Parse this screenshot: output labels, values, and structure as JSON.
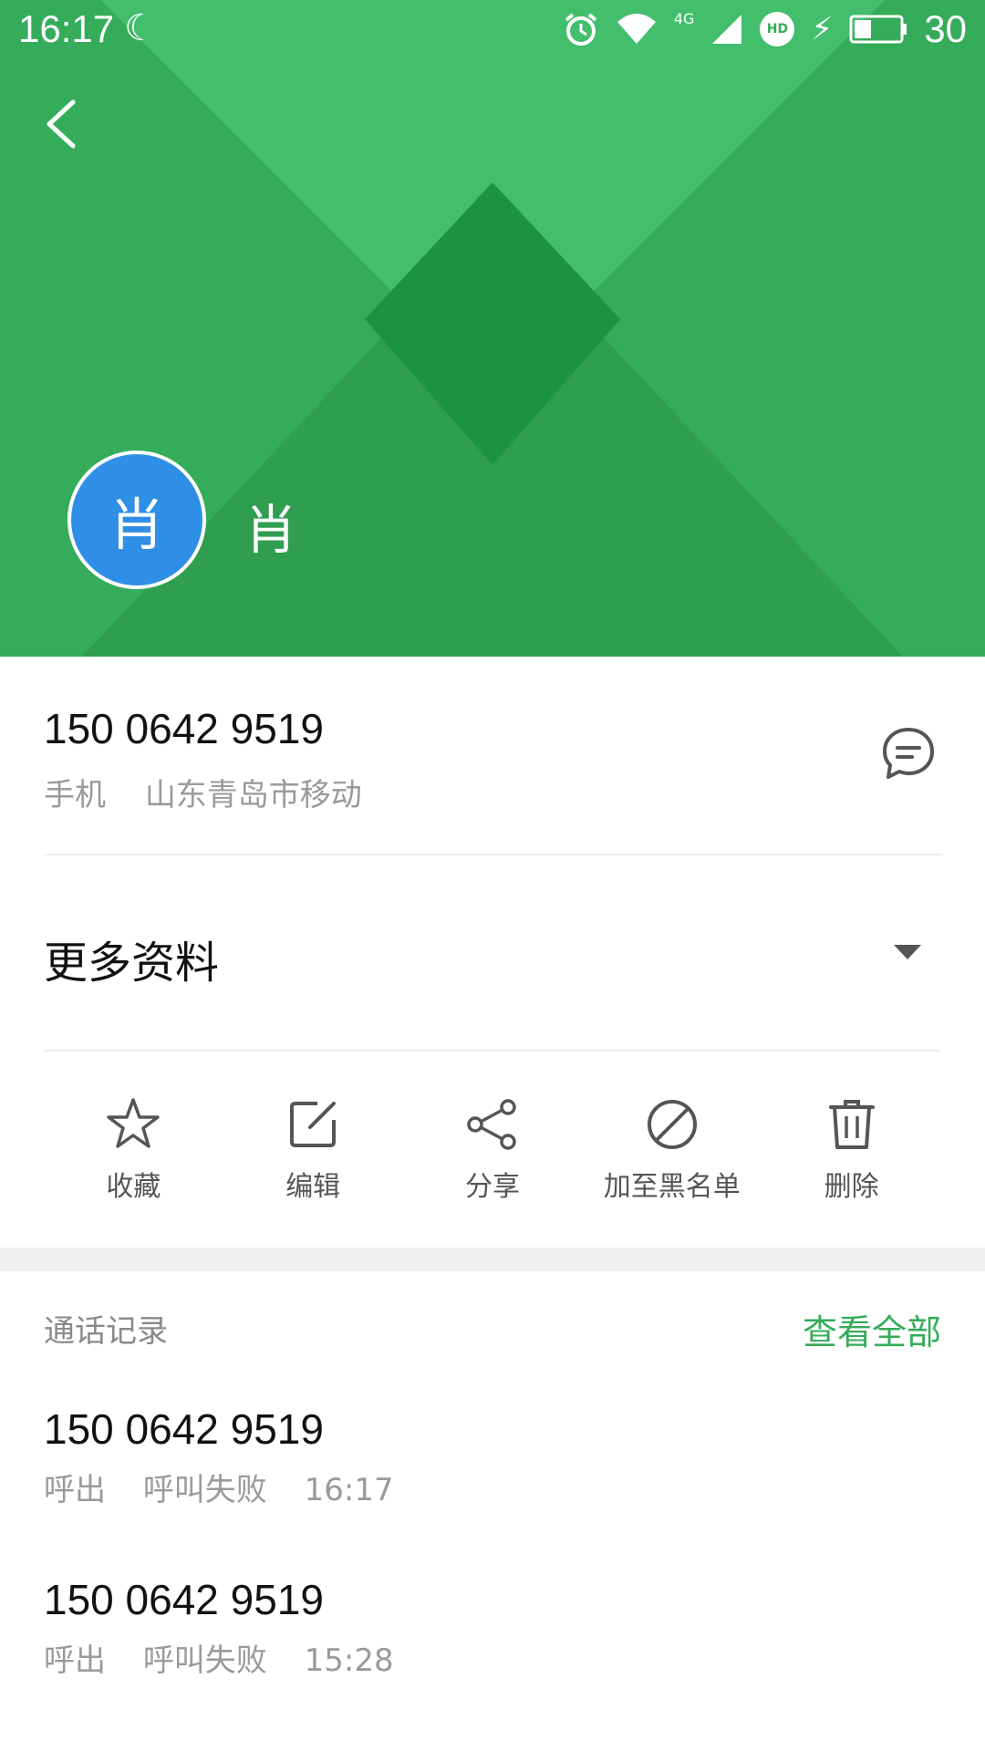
{
  "status_bar": {
    "time": "16:17",
    "network": "4G",
    "hd_badge": "HD",
    "battery_level": "30"
  },
  "contact": {
    "avatar_initial": "肖",
    "name": "肖",
    "phone_number": "150 0642 9519",
    "phone_type": "手机",
    "location": "山东青岛市移动"
  },
  "more_info": {
    "label": "更多资料"
  },
  "actions": [
    {
      "label": "收藏",
      "icon": "star-icon"
    },
    {
      "label": "编辑",
      "icon": "edit-icon"
    },
    {
      "label": "分享",
      "icon": "share-icon"
    },
    {
      "label": "加至黑名单",
      "icon": "block-icon"
    },
    {
      "label": "删除",
      "icon": "trash-icon"
    }
  ],
  "call_log": {
    "title": "通话记录",
    "view_all": "查看全部",
    "items": [
      {
        "number": "150 0642 9519",
        "direction": "呼出",
        "status": "呼叫失败",
        "time": "16:17"
      },
      {
        "number": "150 0642 9519",
        "direction": "呼出",
        "status": "呼叫失败",
        "time": "15:28"
      }
    ]
  },
  "colors": {
    "header_green": "#35ac5a",
    "accent_green": "#35ac5a",
    "avatar_blue": "#2f8fe6"
  }
}
